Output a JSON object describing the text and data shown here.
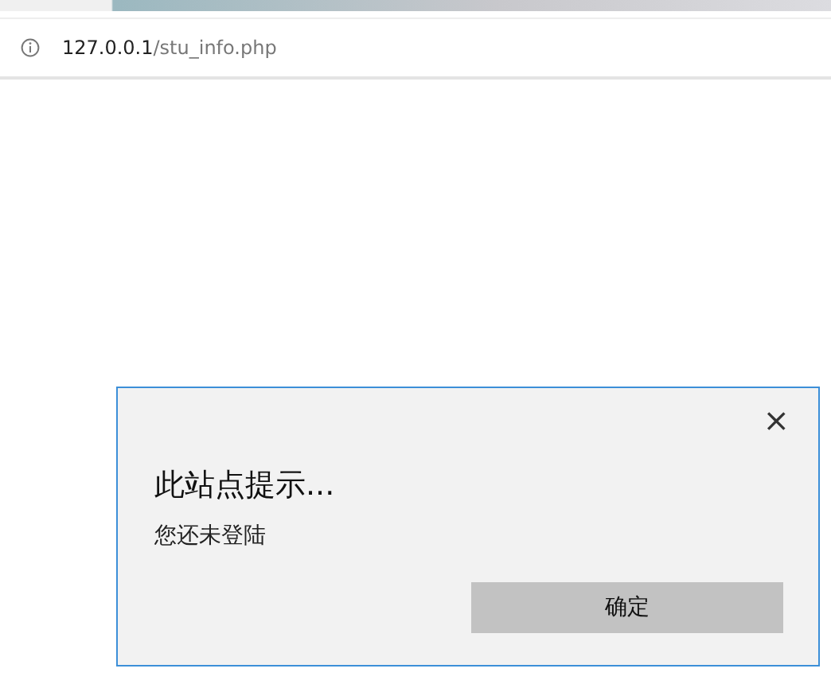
{
  "address_bar": {
    "host": "127.0.0.1",
    "path": "/stu_info.php"
  },
  "dialog": {
    "close": "×",
    "title": "此站点提示...",
    "message": "您还未登陆",
    "buttons": [
      "确定"
    ]
  }
}
